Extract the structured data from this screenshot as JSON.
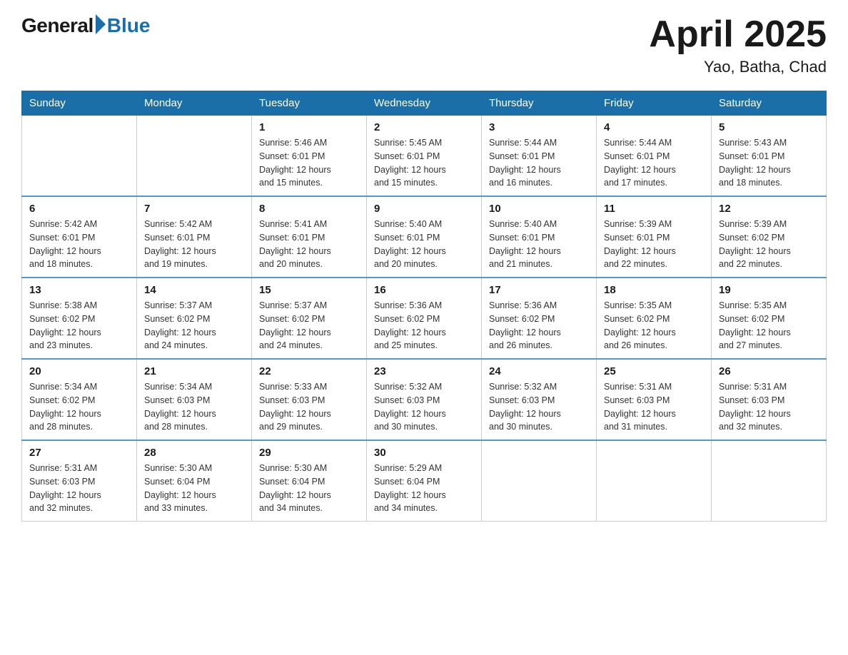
{
  "logo": {
    "general": "General",
    "blue": "Blue"
  },
  "title": {
    "month": "April 2025",
    "location": "Yao, Batha, Chad"
  },
  "weekdays": [
    "Sunday",
    "Monday",
    "Tuesday",
    "Wednesday",
    "Thursday",
    "Friday",
    "Saturday"
  ],
  "weeks": [
    [
      {
        "day": "",
        "info": ""
      },
      {
        "day": "",
        "info": ""
      },
      {
        "day": "1",
        "info": "Sunrise: 5:46 AM\nSunset: 6:01 PM\nDaylight: 12 hours\nand 15 minutes."
      },
      {
        "day": "2",
        "info": "Sunrise: 5:45 AM\nSunset: 6:01 PM\nDaylight: 12 hours\nand 15 minutes."
      },
      {
        "day": "3",
        "info": "Sunrise: 5:44 AM\nSunset: 6:01 PM\nDaylight: 12 hours\nand 16 minutes."
      },
      {
        "day": "4",
        "info": "Sunrise: 5:44 AM\nSunset: 6:01 PM\nDaylight: 12 hours\nand 17 minutes."
      },
      {
        "day": "5",
        "info": "Sunrise: 5:43 AM\nSunset: 6:01 PM\nDaylight: 12 hours\nand 18 minutes."
      }
    ],
    [
      {
        "day": "6",
        "info": "Sunrise: 5:42 AM\nSunset: 6:01 PM\nDaylight: 12 hours\nand 18 minutes."
      },
      {
        "day": "7",
        "info": "Sunrise: 5:42 AM\nSunset: 6:01 PM\nDaylight: 12 hours\nand 19 minutes."
      },
      {
        "day": "8",
        "info": "Sunrise: 5:41 AM\nSunset: 6:01 PM\nDaylight: 12 hours\nand 20 minutes."
      },
      {
        "day": "9",
        "info": "Sunrise: 5:40 AM\nSunset: 6:01 PM\nDaylight: 12 hours\nand 20 minutes."
      },
      {
        "day": "10",
        "info": "Sunrise: 5:40 AM\nSunset: 6:01 PM\nDaylight: 12 hours\nand 21 minutes."
      },
      {
        "day": "11",
        "info": "Sunrise: 5:39 AM\nSunset: 6:01 PM\nDaylight: 12 hours\nand 22 minutes."
      },
      {
        "day": "12",
        "info": "Sunrise: 5:39 AM\nSunset: 6:02 PM\nDaylight: 12 hours\nand 22 minutes."
      }
    ],
    [
      {
        "day": "13",
        "info": "Sunrise: 5:38 AM\nSunset: 6:02 PM\nDaylight: 12 hours\nand 23 minutes."
      },
      {
        "day": "14",
        "info": "Sunrise: 5:37 AM\nSunset: 6:02 PM\nDaylight: 12 hours\nand 24 minutes."
      },
      {
        "day": "15",
        "info": "Sunrise: 5:37 AM\nSunset: 6:02 PM\nDaylight: 12 hours\nand 24 minutes."
      },
      {
        "day": "16",
        "info": "Sunrise: 5:36 AM\nSunset: 6:02 PM\nDaylight: 12 hours\nand 25 minutes."
      },
      {
        "day": "17",
        "info": "Sunrise: 5:36 AM\nSunset: 6:02 PM\nDaylight: 12 hours\nand 26 minutes."
      },
      {
        "day": "18",
        "info": "Sunrise: 5:35 AM\nSunset: 6:02 PM\nDaylight: 12 hours\nand 26 minutes."
      },
      {
        "day": "19",
        "info": "Sunrise: 5:35 AM\nSunset: 6:02 PM\nDaylight: 12 hours\nand 27 minutes."
      }
    ],
    [
      {
        "day": "20",
        "info": "Sunrise: 5:34 AM\nSunset: 6:02 PM\nDaylight: 12 hours\nand 28 minutes."
      },
      {
        "day": "21",
        "info": "Sunrise: 5:34 AM\nSunset: 6:03 PM\nDaylight: 12 hours\nand 28 minutes."
      },
      {
        "day": "22",
        "info": "Sunrise: 5:33 AM\nSunset: 6:03 PM\nDaylight: 12 hours\nand 29 minutes."
      },
      {
        "day": "23",
        "info": "Sunrise: 5:32 AM\nSunset: 6:03 PM\nDaylight: 12 hours\nand 30 minutes."
      },
      {
        "day": "24",
        "info": "Sunrise: 5:32 AM\nSunset: 6:03 PM\nDaylight: 12 hours\nand 30 minutes."
      },
      {
        "day": "25",
        "info": "Sunrise: 5:31 AM\nSunset: 6:03 PM\nDaylight: 12 hours\nand 31 minutes."
      },
      {
        "day": "26",
        "info": "Sunrise: 5:31 AM\nSunset: 6:03 PM\nDaylight: 12 hours\nand 32 minutes."
      }
    ],
    [
      {
        "day": "27",
        "info": "Sunrise: 5:31 AM\nSunset: 6:03 PM\nDaylight: 12 hours\nand 32 minutes."
      },
      {
        "day": "28",
        "info": "Sunrise: 5:30 AM\nSunset: 6:04 PM\nDaylight: 12 hours\nand 33 minutes."
      },
      {
        "day": "29",
        "info": "Sunrise: 5:30 AM\nSunset: 6:04 PM\nDaylight: 12 hours\nand 34 minutes."
      },
      {
        "day": "30",
        "info": "Sunrise: 5:29 AM\nSunset: 6:04 PM\nDaylight: 12 hours\nand 34 minutes."
      },
      {
        "day": "",
        "info": ""
      },
      {
        "day": "",
        "info": ""
      },
      {
        "day": "",
        "info": ""
      }
    ]
  ]
}
